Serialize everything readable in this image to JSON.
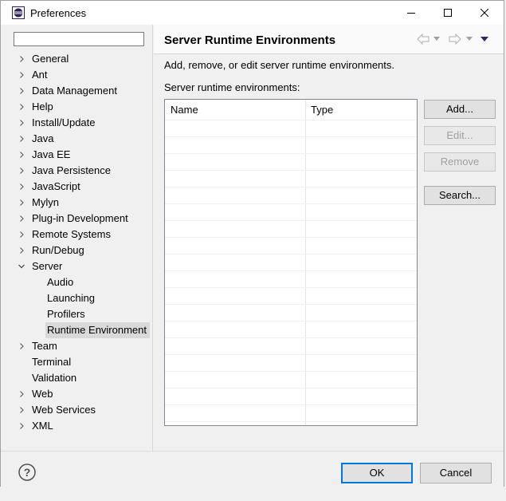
{
  "window": {
    "title": "Preferences"
  },
  "filter": {
    "value": "",
    "placeholder": ""
  },
  "tree": {
    "items": [
      {
        "label": "General",
        "expandable": true,
        "expanded": false,
        "level": 0
      },
      {
        "label": "Ant",
        "expandable": true,
        "expanded": false,
        "level": 0
      },
      {
        "label": "Data Management",
        "expandable": true,
        "expanded": false,
        "level": 0
      },
      {
        "label": "Help",
        "expandable": true,
        "expanded": false,
        "level": 0
      },
      {
        "label": "Install/Update",
        "expandable": true,
        "expanded": false,
        "level": 0
      },
      {
        "label": "Java",
        "expandable": true,
        "expanded": false,
        "level": 0
      },
      {
        "label": "Java EE",
        "expandable": true,
        "expanded": false,
        "level": 0
      },
      {
        "label": "Java Persistence",
        "expandable": true,
        "expanded": false,
        "level": 0
      },
      {
        "label": "JavaScript",
        "expandable": true,
        "expanded": false,
        "level": 0
      },
      {
        "label": "Mylyn",
        "expandable": true,
        "expanded": false,
        "level": 0
      },
      {
        "label": "Plug-in Development",
        "expandable": true,
        "expanded": false,
        "level": 0
      },
      {
        "label": "Remote Systems",
        "expandable": true,
        "expanded": false,
        "level": 0
      },
      {
        "label": "Run/Debug",
        "expandable": true,
        "expanded": false,
        "level": 0
      },
      {
        "label": "Server",
        "expandable": true,
        "expanded": true,
        "level": 0
      },
      {
        "label": "Audio",
        "expandable": false,
        "expanded": false,
        "level": 1
      },
      {
        "label": "Launching",
        "expandable": false,
        "expanded": false,
        "level": 1
      },
      {
        "label": "Profilers",
        "expandable": false,
        "expanded": false,
        "level": 1
      },
      {
        "label": "Runtime Environment",
        "expandable": false,
        "expanded": false,
        "level": 1,
        "selected": true
      },
      {
        "label": "Team",
        "expandable": true,
        "expanded": false,
        "level": 0
      },
      {
        "label": "Terminal",
        "expandable": false,
        "expanded": false,
        "level": 0
      },
      {
        "label": "Validation",
        "expandable": false,
        "expanded": false,
        "level": 0
      },
      {
        "label": "Web",
        "expandable": true,
        "expanded": false,
        "level": 0
      },
      {
        "label": "Web Services",
        "expandable": true,
        "expanded": false,
        "level": 0
      },
      {
        "label": "XML",
        "expandable": true,
        "expanded": false,
        "level": 0
      }
    ]
  },
  "page": {
    "title": "Server Runtime Environments",
    "description": "Add, remove, or edit server runtime environments.",
    "table_label": "Server runtime environments:",
    "columns": [
      "Name",
      "Type"
    ],
    "rows": []
  },
  "buttons": {
    "add": "Add...",
    "edit": "Edit...",
    "remove": "Remove",
    "search": "Search..."
  },
  "footer": {
    "ok": "OK",
    "cancel": "Cancel"
  },
  "colors": {
    "accent": "#0078d7",
    "selection": "#d9d9d9",
    "disabled_text": "#a0a0a0"
  }
}
